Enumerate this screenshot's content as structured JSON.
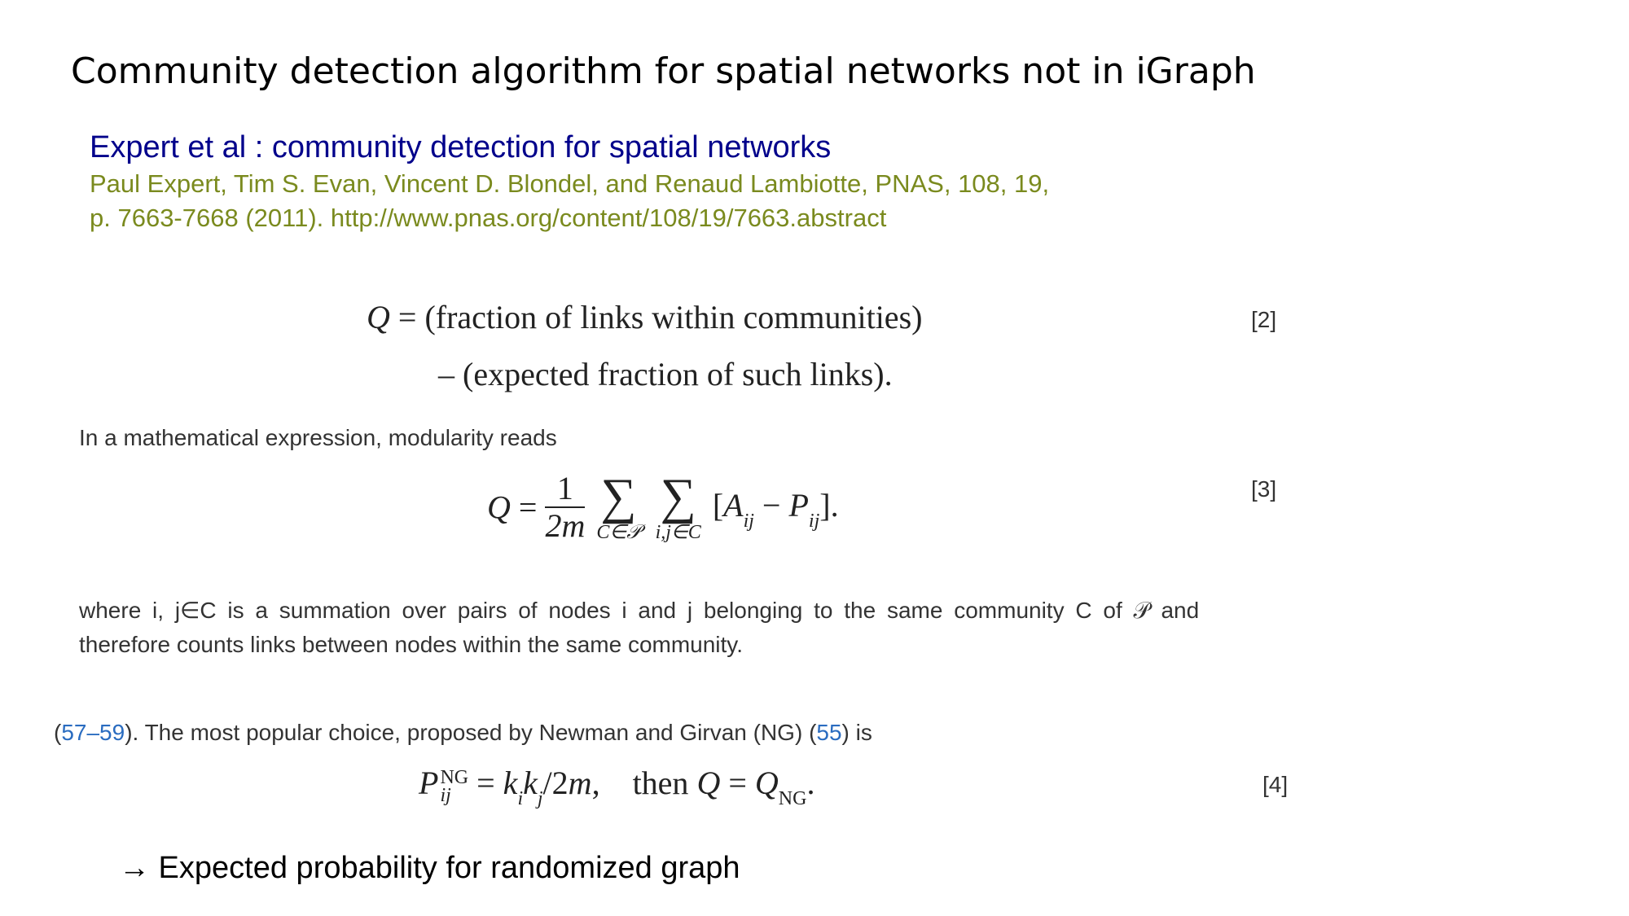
{
  "slide": {
    "title": "Community detection algorithm for spatial networks not in iGraph",
    "footer": "→ Expected probability for randomized graph"
  },
  "reference": {
    "heading": "Expert et al : community detection for spatial networks",
    "authors": "Paul Expert, Tim S. Evan, Vincent D. Blondel, and Renaud Lambiotte, PNAS, 108, 19,",
    "publication": "p. 7663-7668 (2011). http://www.pnas.org/content/108/19/7663.abstract"
  },
  "equations": {
    "eq2": {
      "line1": "(fraction of links within communities)",
      "line2": "– (expected fraction of such links).",
      "number": "[2]"
    },
    "eq3": {
      "numerator": "1",
      "denominator": "2m",
      "sum1_sub": "C∈𝒫",
      "sum2_sub": "i,j∈C",
      "number": "[3]"
    },
    "eq4": {
      "then": "then",
      "number": "[4]"
    }
  },
  "prose": {
    "intro": "In a mathematical expression, modularity reads",
    "where_line1": "where i, j∈C is a summation over pairs of nodes i and j belonging to the same community C of 𝒫 and",
    "where_line2": "therefore counts links between nodes within the same community.",
    "ng_cite1": "57–59",
    "ng_text": "). The most popular choice, proposed by Newman and Girvan (NG) (",
    "ng_cite2": "55",
    "ng_end": ") is"
  }
}
